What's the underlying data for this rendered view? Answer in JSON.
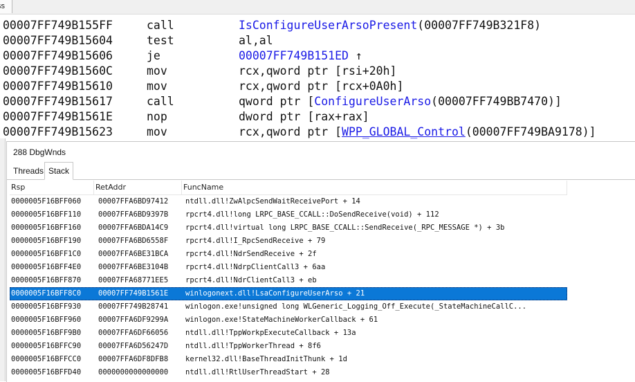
{
  "topbar": {
    "stub_text": "ss"
  },
  "disassembly": [
    {
      "addr": "00007FF749B155FF",
      "mnemonic": "call",
      "parts": [
        {
          "t": "IsConfigureUserArsoPresent",
          "c": "sym"
        },
        {
          "t": "(00007FF749B321F8)",
          "c": ""
        }
      ]
    },
    {
      "addr": "00007FF749B15604",
      "mnemonic": "test",
      "parts": [
        {
          "t": "al,al",
          "c": ""
        }
      ]
    },
    {
      "addr": "00007FF749B15606",
      "mnemonic": "je",
      "parts": [
        {
          "t": "00007FF749B151ED",
          "c": "sym"
        },
        {
          "t": " ↑",
          "c": ""
        }
      ]
    },
    {
      "addr": "00007FF749B1560C",
      "mnemonic": "mov",
      "parts": [
        {
          "t": "rcx,qword ptr [rsi+20h]",
          "c": ""
        }
      ]
    },
    {
      "addr": "00007FF749B15610",
      "mnemonic": "mov",
      "parts": [
        {
          "t": "rcx,qword ptr [rcx+0A0h]",
          "c": ""
        }
      ]
    },
    {
      "addr": "00007FF749B15617",
      "mnemonic": "call",
      "parts": [
        {
          "t": "qword ptr [",
          "c": ""
        },
        {
          "t": "ConfigureUserArso",
          "c": "sym"
        },
        {
          "t": "(00007FF749BB7470)]",
          "c": ""
        }
      ]
    },
    {
      "addr": "00007FF749B1561E",
      "mnemonic": "nop",
      "parts": [
        {
          "t": "dword ptr [rax+rax]",
          "c": ""
        }
      ]
    },
    {
      "addr": "00007FF749B15623",
      "mnemonic": "mov",
      "parts": [
        {
          "t": "rcx,qword ptr [",
          "c": ""
        },
        {
          "t": "WPP_GLOBAL_Control",
          "c": "symu"
        },
        {
          "t": "(00007FF749BA9178)]",
          "c": ""
        }
      ]
    }
  ],
  "stack_window": {
    "title": "288 DbgWnds",
    "tabs": [
      {
        "label": "Threads"
      },
      {
        "label": "Stack"
      }
    ],
    "active_tab": "Stack",
    "columns": [
      "Rsp",
      "RetAddr",
      "FuncName"
    ],
    "selected_index": 7,
    "rows": [
      [
        "0000005F16BFF060",
        "00007FFA6BD97412",
        "ntdll.dll!ZwAlpcSendWaitReceivePort + 14"
      ],
      [
        "0000005F16BFF110",
        "00007FFA6BD9397B",
        "rpcrt4.dll!long LRPC_BASE_CCALL::DoSendReceive(void) + 112"
      ],
      [
        "0000005F16BFF160",
        "00007FFA6BDA14C9",
        "rpcrt4.dll!virtual long LRPC_BASE_CCALL::SendReceive(_RPC_MESSAGE *) + 3b"
      ],
      [
        "0000005F16BFF190",
        "00007FFA6BD6558F",
        "rpcrt4.dll!I_RpcSendReceive + 79"
      ],
      [
        "0000005F16BFF1C0",
        "00007FFA6BE31BCA",
        "rpcrt4.dll!NdrSendReceive + 2f"
      ],
      [
        "0000005F16BFF4E0",
        "00007FFA6BE3104B",
        "rpcrt4.dll!NdrpClientCall3 + 6aa"
      ],
      [
        "0000005F16BFF870",
        "00007FFA68771EE5",
        "rpcrt4.dll!NdrClientCall3 + eb"
      ],
      [
        "0000005F16BFF8C0",
        "00007FF749B1561E",
        "winlogonext.dll!LsaConfigureUserArso + 21"
      ],
      [
        "0000005F16BFF930",
        "00007FF749B28741",
        "winlogon.exe!unsigned long WLGeneric_Logging_Off_Execute(_StateMachineCallC..."
      ],
      [
        "0000005F16BFF960",
        "00007FFA6DF9299A",
        "winlogon.exe!StateMachineWorkerCallback + 61"
      ],
      [
        "0000005F16BFF9B0",
        "00007FFA6DF66056",
        "ntdll.dll!TppWorkpExecuteCallback + 13a"
      ],
      [
        "0000005F16BFFC90",
        "00007FFA6D56247D",
        "ntdll.dll!TppWorkerThread + 8f6"
      ],
      [
        "0000005F16BFFCC0",
        "00007FFA6DF8DFB8",
        "kernel32.dll!BaseThreadInitThunk + 1d"
      ],
      [
        "0000005F16BFFD40",
        "0000000000000000",
        "ntdll.dll!RtlUserThreadStart + 28"
      ]
    ]
  }
}
